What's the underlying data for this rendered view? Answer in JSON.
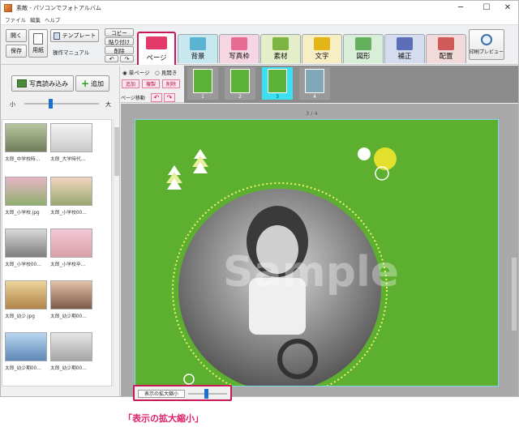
{
  "window": {
    "title": "素敵 - パソコンでフォトアルバム",
    "minimize": "─",
    "maximize": "☐",
    "close": "✕"
  },
  "menu": [
    "ファイル",
    "編集",
    "ヘルプ"
  ],
  "toolbar": {
    "open": "開く",
    "save": "保存",
    "paper": "用紙",
    "template": "テンプレート",
    "manual": "操作マニュアル",
    "copy": "コピー",
    "paste": "貼り付け",
    "delete": "削除",
    "undo": "↶",
    "redo": "↷",
    "print_preview": "印刷プレビュー"
  },
  "tabs": [
    {
      "label": "ページ",
      "color": "#ffffff",
      "icon": "#e33a6a"
    },
    {
      "label": "背景",
      "color": "#c7e8ef",
      "icon": "#5ab3d0"
    },
    {
      "label": "写真枠",
      "color": "#f6d6e2",
      "icon": "#e86b94"
    },
    {
      "label": "素材",
      "color": "#e4eec8",
      "icon": "#7cb342"
    },
    {
      "label": "文字",
      "color": "#f8eec4",
      "icon": "#e3b516"
    },
    {
      "label": "図形",
      "color": "#d9eed8",
      "icon": "#63b05d"
    },
    {
      "label": "補正",
      "color": "#d6dcef",
      "icon": "#5b6fb8"
    },
    {
      "label": "配置",
      "color": "#f2dada",
      "icon": "#d05a5a"
    }
  ],
  "left": {
    "import_btn": "写真読み込み",
    "add_btn": "追加",
    "size_small": "小",
    "size_large": "大",
    "slider_value": 0.35
  },
  "thumbs": [
    {
      "cap": "太郎_中学校時..."
    },
    {
      "cap": "太郎_大学時代..."
    },
    {
      "cap": "太郎_小学校.jpg"
    },
    {
      "cap": "太郎_小学校00..."
    },
    {
      "cap": "太郎_小学校00..."
    },
    {
      "cap": "太郎_小学校卒..."
    },
    {
      "cap": "太郎_幼少.jpg"
    },
    {
      "cap": "太郎_幼少期00..."
    },
    {
      "cap": "太郎_幼少期00..."
    },
    {
      "cap": "太郎_幼少期00..."
    }
  ],
  "pagecontrols": {
    "single": "単ページ",
    "spread": "見開き",
    "add": "追加",
    "copy": "複製",
    "delete": "削除",
    "move": "ページ移動",
    "prev": "↶",
    "next": "↷"
  },
  "pages": [
    {
      "num": "1"
    },
    {
      "num": "2"
    },
    {
      "num": "3"
    },
    {
      "num": "4"
    }
  ],
  "page_indicator": "3 / 4",
  "sample_text": "Sample",
  "zoom": {
    "label": "表示の拡大縮小",
    "value": 0.45
  },
  "annotation": "「表示の拡大縮小」",
  "colors": {
    "page_bg": "#5caf2f",
    "highlight": "#c8185a"
  }
}
